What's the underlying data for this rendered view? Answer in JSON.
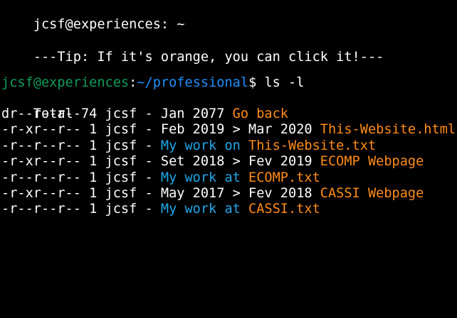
{
  "window": {
    "title": "jcsf@experiences: ~"
  },
  "tip": "---Tip: If it's orange, you can click it!---",
  "prompt": {
    "user_host": "jcsf@experiences",
    "colon": ":",
    "path": "~/professional",
    "dollar": "$",
    "command": " ls -l"
  },
  "total": "Total 7",
  "entries": [
    {
      "perms": "dr--r--r-- 4 jcsf - ",
      "date": "Jan 2077 ",
      "prefix": "",
      "link": "Go back",
      "link_kind": "orange"
    },
    {
      "perms": "-r-xr--r-- 1 jcsf - ",
      "date": "Feb 2019 > Mar 2020 ",
      "prefix": "",
      "link": "This-Website.html",
      "link_kind": "orange"
    },
    {
      "perms": "-r--r--r-- 1 jcsf - ",
      "date": "",
      "prefix": "My work on ",
      "link": "This-Website.txt",
      "link_kind": "orange"
    },
    {
      "perms": "-r-xr--r-- 1 jcsf - ",
      "date": "Set 2018 > Fev 2019 ",
      "prefix": "",
      "link": "ECOMP Webpage",
      "link_kind": "orange"
    },
    {
      "perms": "-r--r--r-- 1 jcsf - ",
      "date": "",
      "prefix": "My work at ",
      "link": "ECOMP.txt",
      "link_kind": "orange"
    },
    {
      "perms": "-r-xr--r-- 1 jcsf - ",
      "date": "May 2017 > Fev 2018 ",
      "prefix": "",
      "link": "CASSI Webpage",
      "link_kind": "orange"
    },
    {
      "perms": "-r--r--r-- 1 jcsf - ",
      "date": "",
      "prefix": "My work at ",
      "link": "CASSI.txt",
      "link_kind": "orange"
    }
  ],
  "colors": {
    "background": "#000000",
    "text": "#ffffff",
    "user_host": "#0f9d58",
    "path": "#1e90ff",
    "description": "#21a7e8",
    "link": "#ff8c1a"
  }
}
